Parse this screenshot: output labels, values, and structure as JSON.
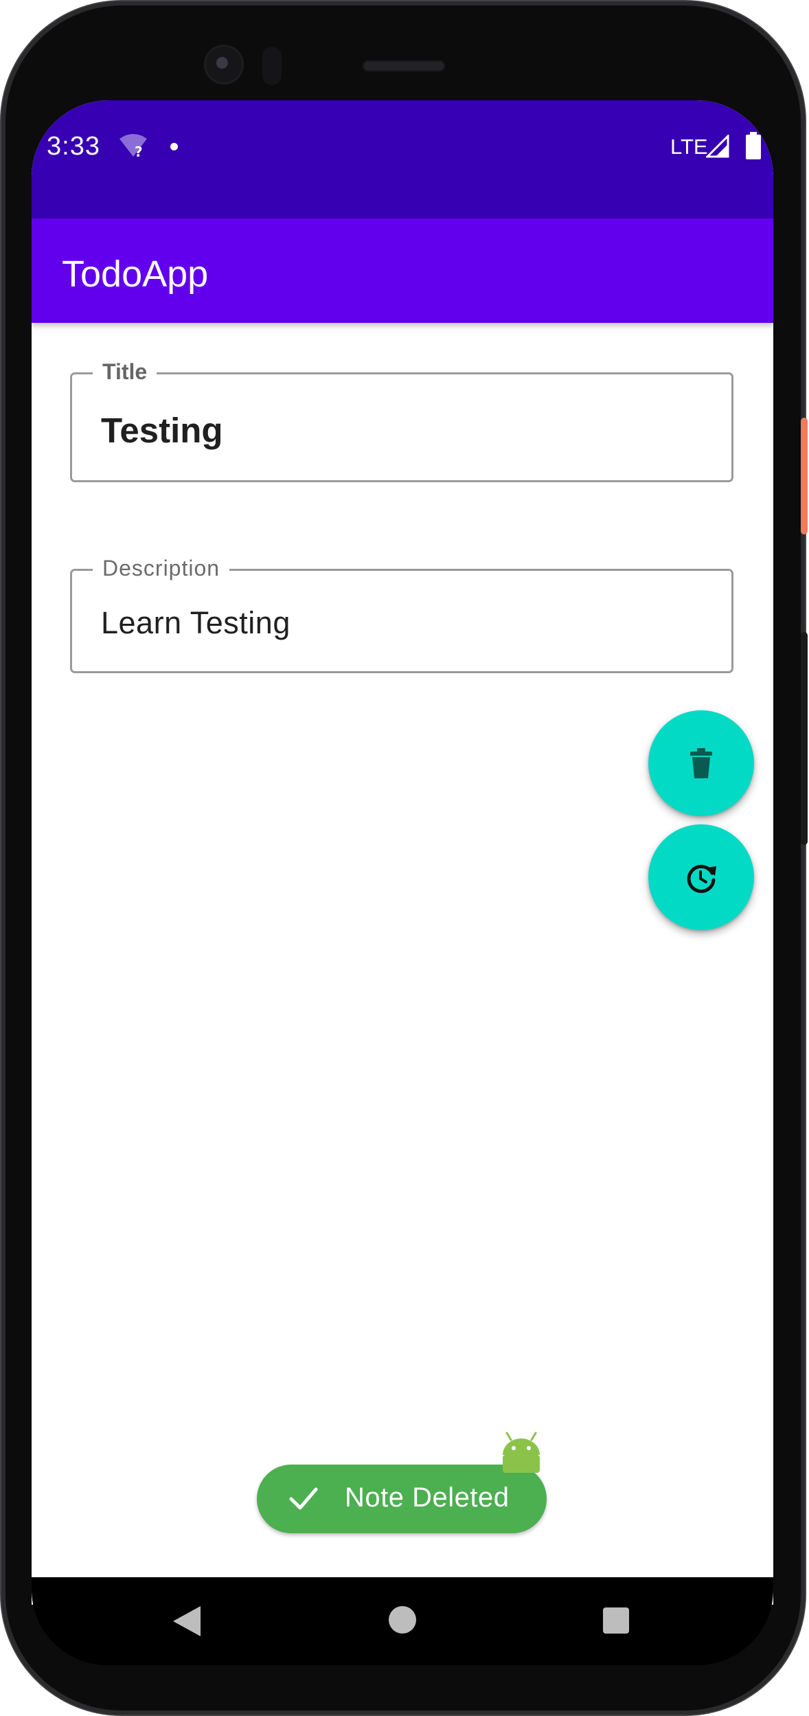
{
  "status_bar": {
    "time": "3:33",
    "network": "LTE",
    "icons": [
      "wifi-unknown-icon",
      "notification-dot-icon",
      "signal-icon",
      "battery-icon"
    ]
  },
  "app_bar": {
    "title": "TodoApp"
  },
  "form": {
    "title_field": {
      "label": "Title",
      "value": "Testing"
    },
    "description_field": {
      "label": "Description",
      "value": "Learn Testing"
    }
  },
  "fabs": {
    "delete_icon": "trash-icon",
    "restore_icon": "restore-clock-icon"
  },
  "toast": {
    "message": "Note Deleted",
    "icon": "checkmark-icon"
  },
  "nav_bar": {
    "icons": [
      "back-icon",
      "home-icon",
      "recents-icon"
    ]
  },
  "colors": {
    "status_bar": "#3700b3",
    "app_bar": "#6200ee",
    "fab": "#03dac5",
    "toast": "#4caf50",
    "field_border": "#9a9a9a"
  }
}
